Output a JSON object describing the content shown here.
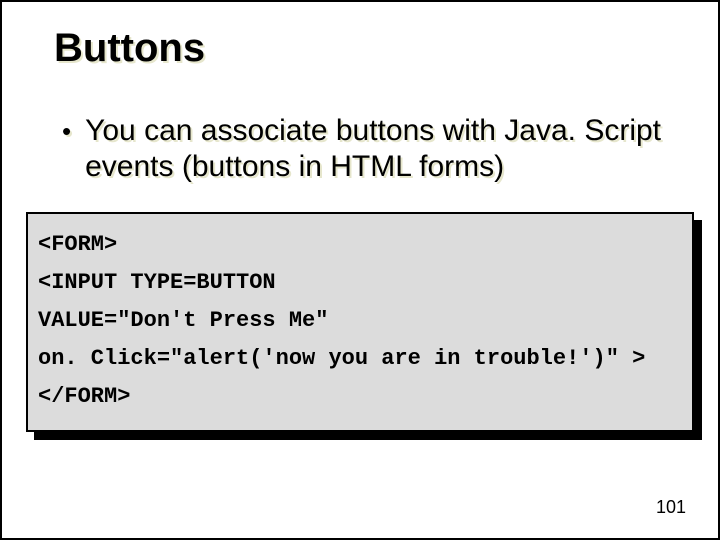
{
  "title": "Buttons",
  "bullet": "You can associate buttons with Java. Script events (buttons in HTML forms)",
  "code": {
    "l1": "<FORM>",
    "l2": "<INPUT TYPE=BUTTON",
    "l3": "VALUE=\"Don't Press Me\"",
    "l4": "on. Click=\"alert('now you are in trouble!')\" >",
    "l5": "</FORM>"
  },
  "page_number": "101"
}
